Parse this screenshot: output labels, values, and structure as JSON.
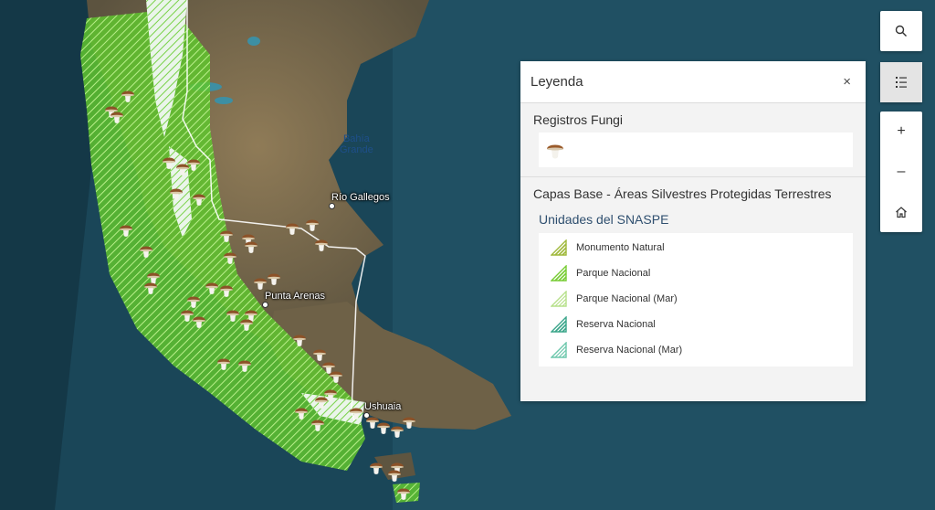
{
  "map": {
    "labels": {
      "bahia": "Bahía\nGrande",
      "rio_gallegos": "Río Gallegos",
      "punta_arenas": "Punta Arenas",
      "ushuaia": "Ushuaia"
    },
    "colors": {
      "ocean": "#163f4f",
      "land": "#7a6a4e",
      "protected_green": "#5fc42e",
      "ice": "#e8f2ea",
      "border": "#ffffff"
    }
  },
  "controls": {
    "search": "search-icon",
    "legend": "legend-list-icon",
    "zoom_in": "+",
    "zoom_out": "–",
    "home": "home-icon"
  },
  "legend": {
    "title": "Leyenda",
    "close": "×",
    "layers": [
      {
        "title": "Registros Fungi",
        "symbol": "mushroom-icon"
      },
      {
        "title": "Capas Base - Áreas Silvestres Protegidas Terrestres",
        "subtitle": "Unidades del SNASPE",
        "items": [
          {
            "label": "Monumento Natural",
            "color": "#9fb83a",
            "pattern": "hatch"
          },
          {
            "label": "Parque Nacional",
            "color": "#77cc33",
            "pattern": "hatch"
          },
          {
            "label": "Parque Nacional (Mar)",
            "color": "#b6e08a",
            "pattern": "hatch-light"
          },
          {
            "label": "Reserva Nacional",
            "color": "#3aa58a",
            "pattern": "hatch"
          },
          {
            "label": "Reserva Nacional (Mar)",
            "color": "#6cc7ac",
            "pattern": "hatch-light"
          }
        ]
      }
    ]
  }
}
